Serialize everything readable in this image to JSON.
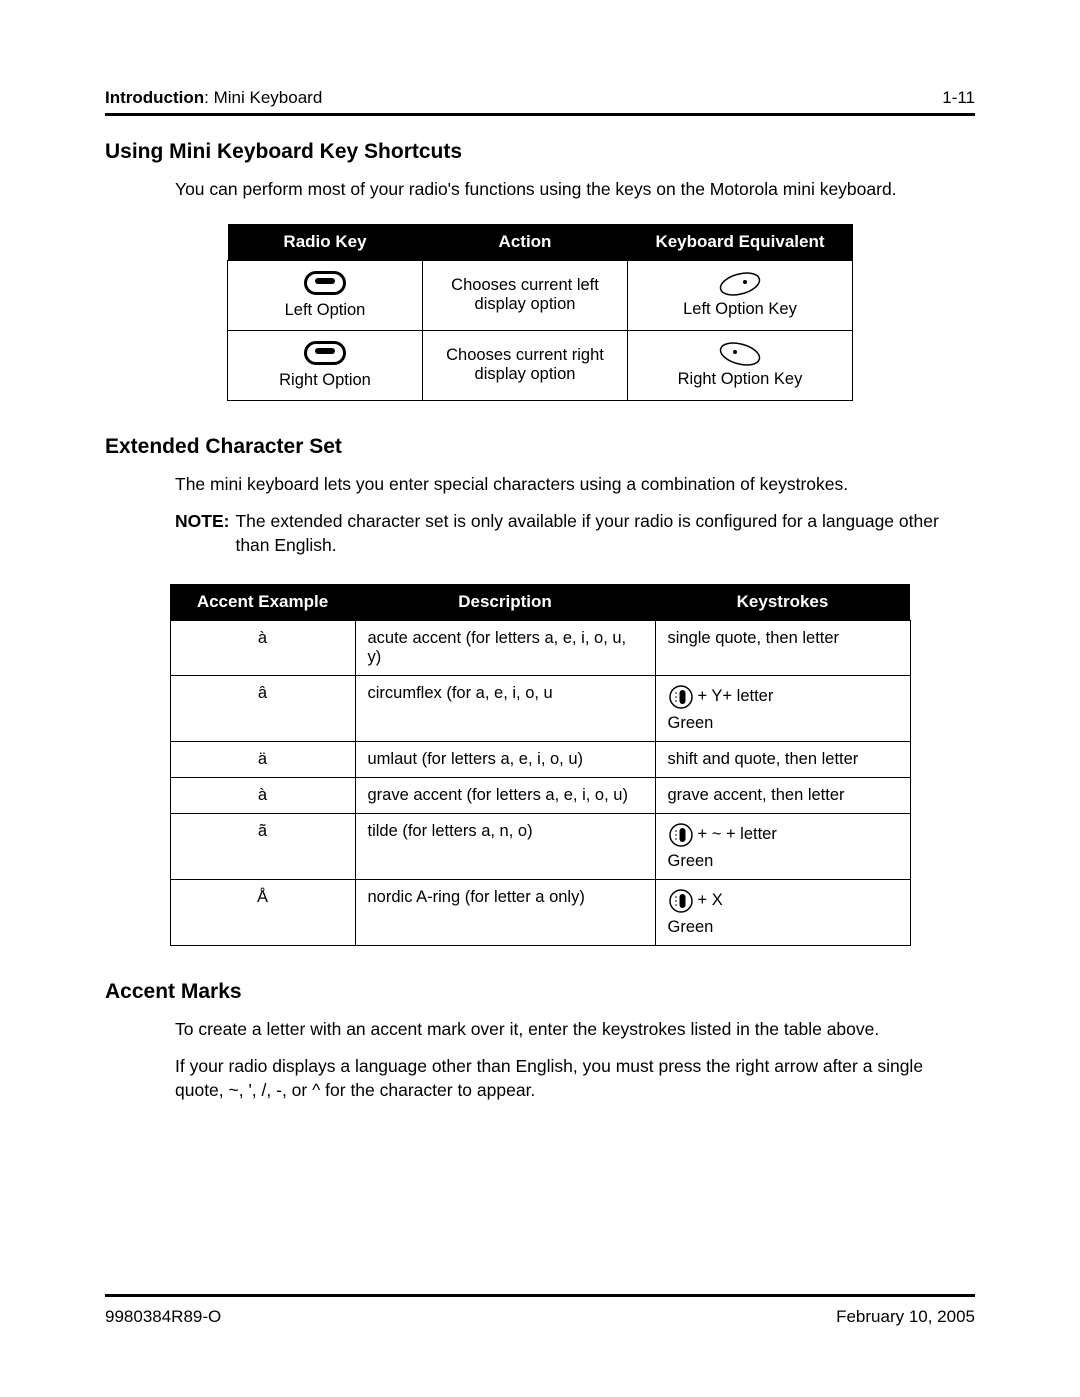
{
  "header": {
    "section_bold": "Introduction",
    "section_rest": ": Mini Keyboard",
    "page_number": "1-11"
  },
  "section1": {
    "heading": "Using Mini Keyboard Key Shortcuts",
    "body": "You can perform most of your radio's functions using the keys on the Motorola mini keyboard."
  },
  "table1": {
    "headers": [
      "Radio Key",
      "Action",
      "Keyboard Equivalent"
    ],
    "rows": [
      {
        "radio_label": "Left Option",
        "action": "Chooses current left display option",
        "equiv_label": "Left Option Key"
      },
      {
        "radio_label": "Right Option",
        "action": "Chooses current right display option",
        "equiv_label": "Right Option Key"
      }
    ]
  },
  "section2": {
    "heading": "Extended Character Set",
    "body": "The mini keyboard lets you enter special characters using a combination of keystrokes.",
    "note_label": "NOTE:",
    "note_body": "The extended character set is only available if your radio is configured for a language other than English."
  },
  "table2": {
    "headers": [
      "Accent Example",
      "Description",
      "Keystrokes"
    ],
    "rows": [
      {
        "example": "à",
        "description": "acute accent (for letters a, e, i, o, u, y)",
        "keystroke_text": "single quote, then letter",
        "has_green": false
      },
      {
        "example": "â",
        "description": "circumflex (for a, e, i, o, u",
        "keystroke_text": "+ Y+ letter",
        "has_green": true,
        "green_label": "Green"
      },
      {
        "example": "ä",
        "description": "umlaut (for letters a, e, i, o, u)",
        "keystroke_text": "shift and quote, then letter",
        "has_green": false
      },
      {
        "example": "à",
        "description": "grave accent (for letters a, e, i, o, u)",
        "keystroke_text": "grave accent, then letter",
        "has_green": false
      },
      {
        "example": "ã",
        "description": "tilde (for letters a, n, o)",
        "keystroke_text": "+ ~ + letter",
        "has_green": true,
        "green_label": "Green"
      },
      {
        "example": "Å",
        "description": "nordic A-ring (for letter a only)",
        "keystroke_text": "+ X",
        "has_green": true,
        "green_label": "Green"
      }
    ]
  },
  "section3": {
    "heading": "Accent Marks",
    "body1": "To create a letter with an accent mark over it, enter the keystrokes listed in the table above.",
    "body2": "If your radio displays a language other than English, you must press the right arrow after a single quote, ~, ', /, -, or ^ for the character to appear."
  },
  "footer": {
    "doc_number": "9980384R89-O",
    "date": "February 10, 2005"
  }
}
